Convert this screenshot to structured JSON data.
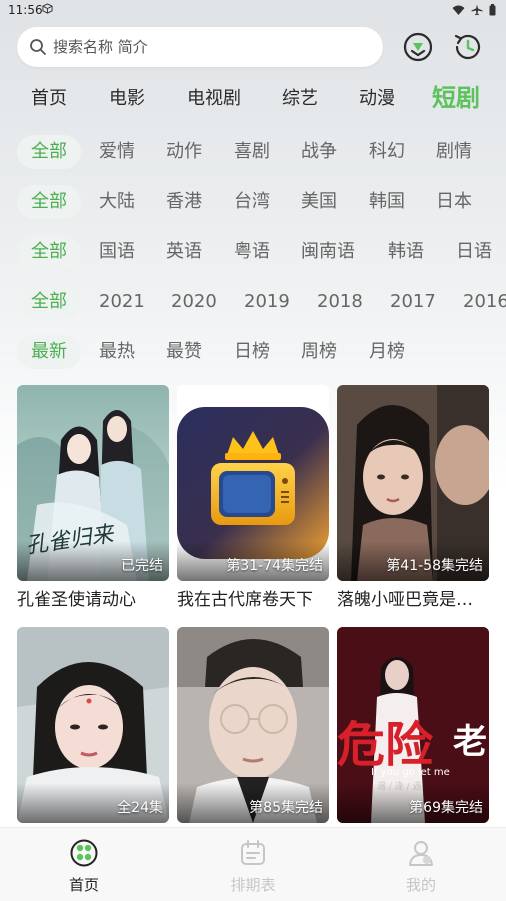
{
  "status": {
    "time": "11:56"
  },
  "search": {
    "placeholder": "搜索名称 简介"
  },
  "top_icons": [
    "download-icon",
    "history-icon"
  ],
  "nav": {
    "tabs": [
      {
        "label": "首页"
      },
      {
        "label": "电影"
      },
      {
        "label": "电视剧"
      },
      {
        "label": "综艺"
      },
      {
        "label": "动漫"
      },
      {
        "label": "短剧",
        "active": true
      }
    ]
  },
  "filters": {
    "genre": [
      "全部",
      "爱情",
      "动作",
      "喜剧",
      "战争",
      "科幻",
      "剧情"
    ],
    "region": [
      "全部",
      "大陆",
      "香港",
      "台湾",
      "美国",
      "韩国",
      "日本"
    ],
    "language": [
      "全部",
      "国语",
      "英语",
      "粤语",
      "闽南语",
      "韩语",
      "日语"
    ],
    "year": [
      "全部",
      "2021",
      "2020",
      "2019",
      "2018",
      "2017",
      "2016"
    ],
    "sort": [
      "最新",
      "最热",
      "最赞",
      "日榜",
      "周榜",
      "月榜"
    ]
  },
  "cards": [
    {
      "title": "孔雀圣使请动心",
      "badge": "已完结"
    },
    {
      "title": "我在古代席卷天下",
      "badge": "第31-74集完结"
    },
    {
      "title": "落魄小哑巴竟是…",
      "badge": "第41-58集完结"
    },
    {
      "title": "",
      "badge": "全24集"
    },
    {
      "title": "",
      "badge": "第85集完结"
    },
    {
      "title": "",
      "badge": "第69集完结"
    }
  ],
  "poster_text": {
    "calligraphy": "孔雀归来",
    "danger_big": "危险",
    "danger_side": "老",
    "english_caption": "If you go let me",
    "caption_small": "遇 / 逢 / 遇"
  },
  "bottom_nav": [
    {
      "label": "首页",
      "icon": "film-reel-icon",
      "active": true
    },
    {
      "label": "排期表",
      "icon": "calendar-icon"
    },
    {
      "label": "我的",
      "icon": "user-icon"
    }
  ]
}
